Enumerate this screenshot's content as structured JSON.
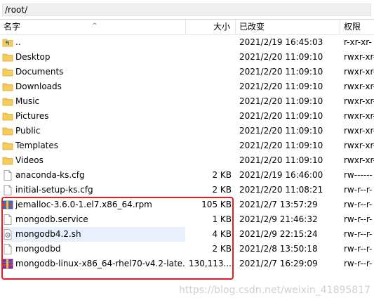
{
  "path": "/root/",
  "columns": {
    "name": "名字",
    "size": "大小",
    "modified": "已改变",
    "perms": "权限"
  },
  "colors": {
    "folder": "#f6cd5b",
    "highlight": "#e8f1fb",
    "redbox": "#e02020"
  },
  "files": [
    {
      "icon": "parent-folder-icon",
      "name": "..",
      "size": "",
      "date": "2021/2/19 16:45:03",
      "perms": "r-xr-xr-"
    },
    {
      "icon": "folder-icon",
      "name": "Desktop",
      "size": "",
      "date": "2021/2/20 11:09:10",
      "perms": "rwxr-xr-"
    },
    {
      "icon": "folder-icon",
      "name": "Documents",
      "size": "",
      "date": "2021/2/20 11:09:10",
      "perms": "rwxr-xr-"
    },
    {
      "icon": "folder-icon",
      "name": "Downloads",
      "size": "",
      "date": "2021/2/20 11:09:10",
      "perms": "rwxr-xr-"
    },
    {
      "icon": "folder-icon",
      "name": "Music",
      "size": "",
      "date": "2021/2/20 11:09:10",
      "perms": "rwxr-xr-"
    },
    {
      "icon": "folder-icon",
      "name": "Pictures",
      "size": "",
      "date": "2021/2/20 11:09:10",
      "perms": "rwxr-xr-"
    },
    {
      "icon": "folder-icon",
      "name": "Public",
      "size": "",
      "date": "2021/2/20 11:09:10",
      "perms": "rwxr-xr-"
    },
    {
      "icon": "folder-icon",
      "name": "Templates",
      "size": "",
      "date": "2021/2/20 11:09:10",
      "perms": "rwxr-xr-"
    },
    {
      "icon": "folder-icon",
      "name": "Videos",
      "size": "",
      "date": "2021/2/20 11:09:10",
      "perms": "rwxr-xr-"
    },
    {
      "icon": "file-icon",
      "name": "anaconda-ks.cfg",
      "size": "2 KB",
      "date": "2021/2/19 16:46:00",
      "perms": "rw------"
    },
    {
      "icon": "file-icon",
      "name": "initial-setup-ks.cfg",
      "size": "2 KB",
      "date": "2021/2/20 11:08:21",
      "perms": "rw-r--r-"
    },
    {
      "icon": "rpm-package-icon",
      "name": "jemalloc-3.6.0-1.el7.x86_64.rpm",
      "size": "105 KB",
      "date": "2021/2/7 13:57:29",
      "perms": "rw-r--r-"
    },
    {
      "icon": "file-icon",
      "name": "mongodb.service",
      "size": "1 KB",
      "date": "2021/2/9 21:46:32",
      "perms": "rw-r--r-"
    },
    {
      "icon": "shell-script-icon",
      "name": "mongodb4.2.sh",
      "size": "4 KB",
      "date": "2021/2/9 22:15:24",
      "perms": "rw-r--r-",
      "highlighted": true
    },
    {
      "icon": "file-icon",
      "name": "mongodbd",
      "size": "2 KB",
      "date": "2021/2/8 13:50:18",
      "perms": "rw-r--r-"
    },
    {
      "icon": "archive-icon",
      "name": "mongodb-linux-x86_64-rhel70-v4.2-late...",
      "size": "130,113...",
      "date": "2021/2/7 16:29:09",
      "perms": "rw-r--r-"
    }
  ],
  "watermark": "https://blog.csdn.net/weixin_41895817"
}
